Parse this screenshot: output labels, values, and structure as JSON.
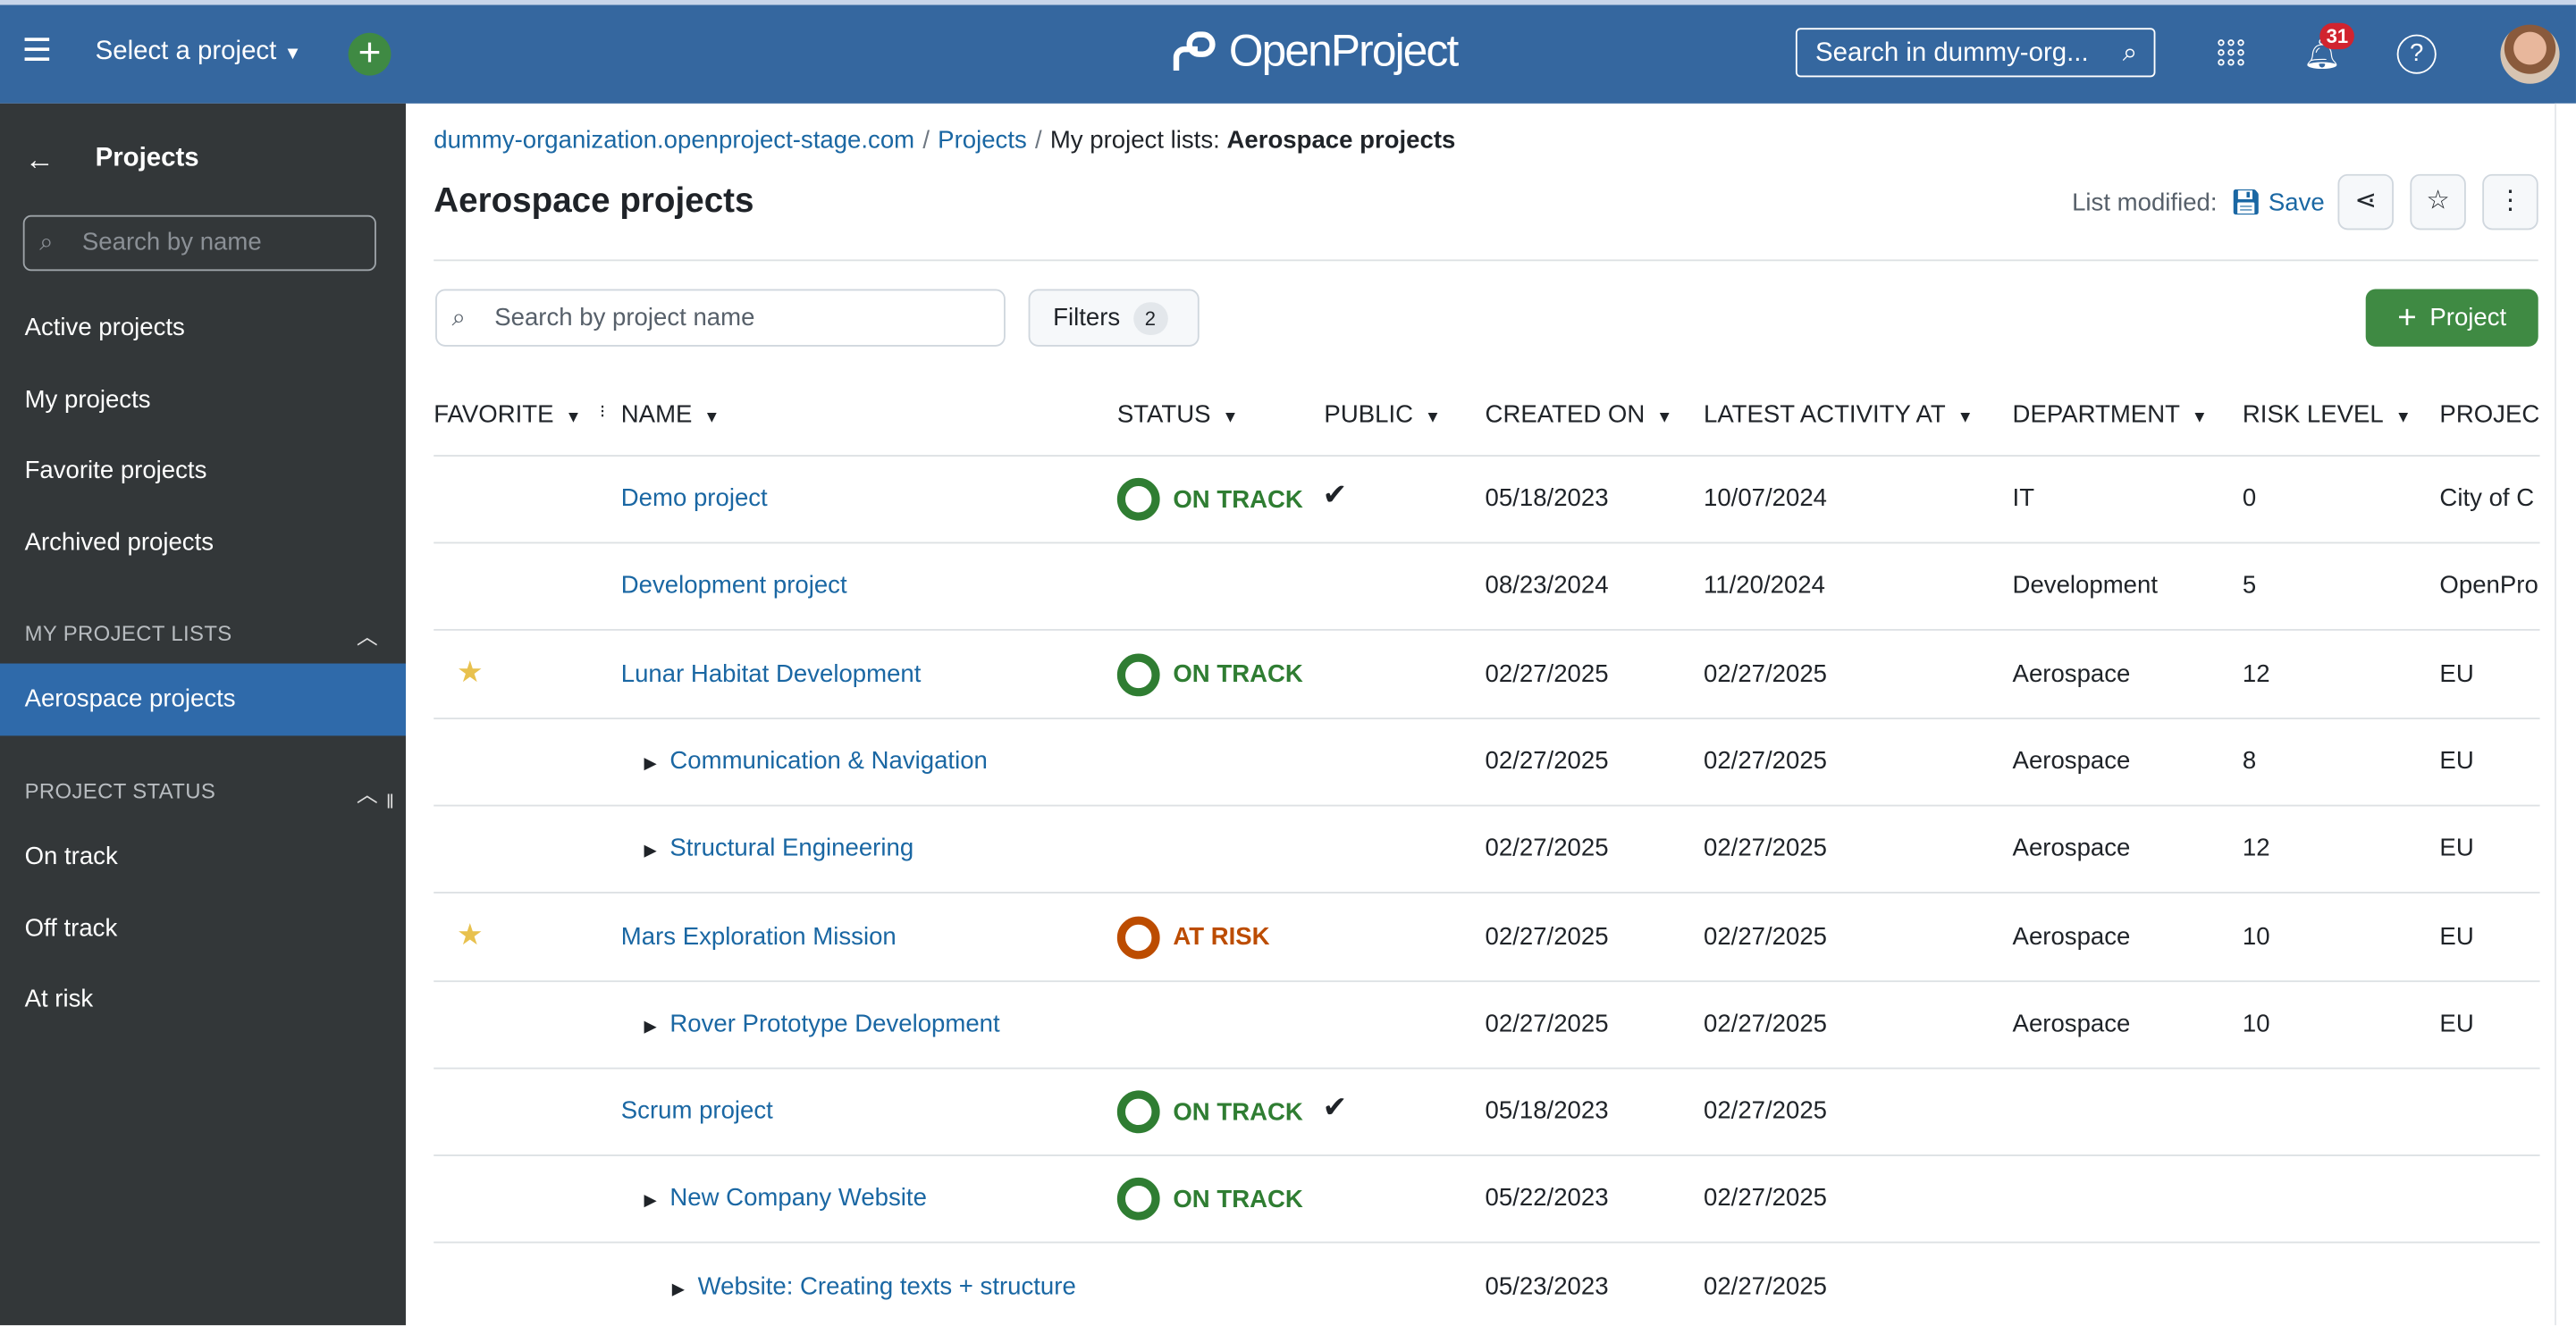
{
  "header": {
    "project_selector": "Select a project",
    "logo_text": "OpenProject",
    "global_search_placeholder": "Search in dummy-org...",
    "notifications_count": "31",
    "help": "?"
  },
  "sidebar": {
    "title": "Projects",
    "search_placeholder": "Search by name",
    "items": [
      {
        "label": "Active projects"
      },
      {
        "label": "My projects"
      },
      {
        "label": "Favorite projects"
      },
      {
        "label": "Archived projects"
      }
    ],
    "my_lists_heading": "MY PROJECT LISTS",
    "my_lists": [
      {
        "label": "Aerospace projects",
        "active": true
      }
    ],
    "status_heading": "PROJECT STATUS",
    "status_items": [
      {
        "label": "On track"
      },
      {
        "label": "Off track"
      },
      {
        "label": "At risk"
      }
    ]
  },
  "breadcrumb": {
    "items": [
      "dummy-organization.openproject-stage.com",
      "Projects"
    ],
    "current_prefix": "My project lists:",
    "current": "Aerospace projects"
  },
  "page": {
    "title": "Aerospace projects",
    "list_modified": "List modified:",
    "save": "Save",
    "search_placeholder": "Search by project name",
    "filters_label": "Filters",
    "filters_count": "2",
    "add_project": "Project"
  },
  "colors": {
    "header": "#35679f",
    "sidebar": "#333739",
    "accent": "#1a67a3",
    "on_track": "#2f7d32",
    "at_risk": "#bc4c00",
    "primary_button": "#3f8a43"
  },
  "table": {
    "columns": [
      "FAVORITE",
      "NAME",
      "STATUS",
      "PUBLIC",
      "CREATED ON",
      "LATEST ACTIVITY AT",
      "DEPARTMENT",
      "RISK LEVEL",
      "PROJEC"
    ],
    "rows": [
      {
        "favorite": false,
        "depth": 0,
        "expandable": false,
        "name": "Demo project",
        "status": "ON TRACK",
        "public": true,
        "created": "05/18/2023",
        "latest": "10/07/2024",
        "department": "IT",
        "risk": "0",
        "project": "City of C"
      },
      {
        "favorite": false,
        "depth": 0,
        "expandable": false,
        "name": "Development project",
        "status": "",
        "public": false,
        "created": "08/23/2024",
        "latest": "11/20/2024",
        "department": "Development",
        "risk": "5",
        "project": "OpenPro"
      },
      {
        "favorite": true,
        "depth": 0,
        "expandable": false,
        "name": "Lunar Habitat Development",
        "status": "ON TRACK",
        "public": false,
        "created": "02/27/2025",
        "latest": "02/27/2025",
        "department": "Aerospace",
        "risk": "12",
        "project": "EU"
      },
      {
        "favorite": false,
        "depth": 1,
        "expandable": true,
        "name": "Communication & Navigation",
        "status": "",
        "public": false,
        "created": "02/27/2025",
        "latest": "02/27/2025",
        "department": "Aerospace",
        "risk": "8",
        "project": "EU"
      },
      {
        "favorite": false,
        "depth": 1,
        "expandable": true,
        "name": "Structural Engineering",
        "status": "",
        "public": false,
        "created": "02/27/2025",
        "latest": "02/27/2025",
        "department": "Aerospace",
        "risk": "12",
        "project": "EU"
      },
      {
        "favorite": true,
        "depth": 0,
        "expandable": false,
        "name": "Mars Exploration Mission",
        "status": "AT RISK",
        "public": false,
        "created": "02/27/2025",
        "latest": "02/27/2025",
        "department": "Aerospace",
        "risk": "10",
        "project": "EU"
      },
      {
        "favorite": false,
        "depth": 1,
        "expandable": true,
        "name": "Rover Prototype Development",
        "status": "",
        "public": false,
        "created": "02/27/2025",
        "latest": "02/27/2025",
        "department": "Aerospace",
        "risk": "10",
        "project": "EU"
      },
      {
        "favorite": false,
        "depth": 0,
        "expandable": false,
        "name": "Scrum project",
        "status": "ON TRACK",
        "public": true,
        "created": "05/18/2023",
        "latest": "02/27/2025",
        "department": "",
        "risk": "",
        "project": ""
      },
      {
        "favorite": false,
        "depth": 1,
        "expandable": true,
        "name": "New Company Website",
        "status": "ON TRACK",
        "public": false,
        "created": "05/22/2023",
        "latest": "02/27/2025",
        "department": "",
        "risk": "",
        "project": ""
      },
      {
        "favorite": false,
        "depth": 2,
        "expandable": true,
        "name": "Website: Creating texts + structure",
        "status": "",
        "public": false,
        "created": "05/23/2023",
        "latest": "02/27/2025",
        "department": "",
        "risk": "",
        "project": ""
      }
    ]
  }
}
